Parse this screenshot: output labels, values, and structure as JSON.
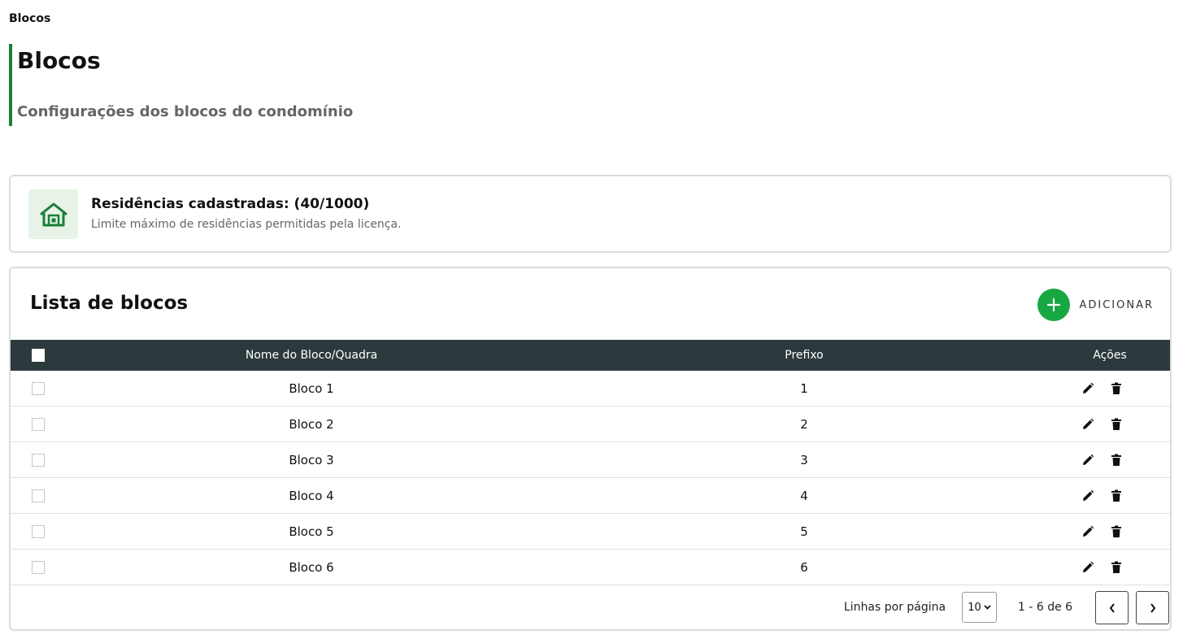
{
  "breadcrumb": "Blocos",
  "header": {
    "title": "Blocos",
    "subtitle": "Configurações dos blocos do condomínio"
  },
  "info": {
    "icon": "house-icon",
    "title": "Residências cadastradas: (40/1000)",
    "description": "Limite máximo de residências permitidas pela licença."
  },
  "list": {
    "title": "Lista de blocos",
    "add_label": "ADICIONAR",
    "columns": {
      "name": "Nome do Bloco/Quadra",
      "prefix": "Prefixo",
      "actions": "Ações"
    },
    "rows": [
      {
        "name": "Bloco 1",
        "prefix": "1"
      },
      {
        "name": "Bloco 2",
        "prefix": "2"
      },
      {
        "name": "Bloco 3",
        "prefix": "3"
      },
      {
        "name": "Bloco 4",
        "prefix": "4"
      },
      {
        "name": "Bloco 5",
        "prefix": "5"
      },
      {
        "name": "Bloco 6",
        "prefix": "6"
      }
    ]
  },
  "pagination": {
    "rows_per_page_label": "Linhas por página",
    "rows_per_page_value": "10",
    "range": "1 - 6 de 6"
  },
  "colors": {
    "accent": "#1a7f37",
    "add_button": "#17a843",
    "table_header": "#2c3a3d"
  }
}
